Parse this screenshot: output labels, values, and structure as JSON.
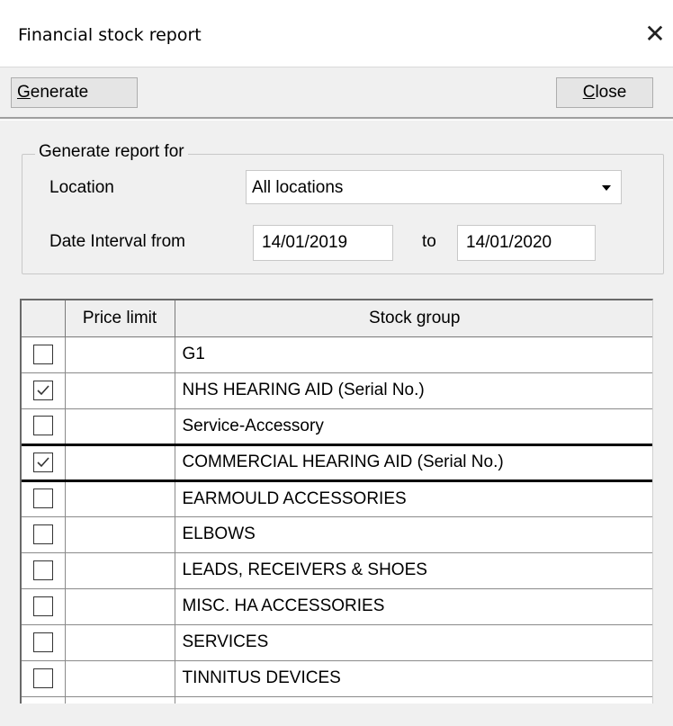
{
  "window": {
    "title": "Financial stock report",
    "close_glyph": "✕"
  },
  "toolbar": {
    "generate": {
      "mnemonic": "G",
      "rest": "enerate"
    },
    "close": {
      "mnemonic": "C",
      "rest": "lose"
    }
  },
  "report_for": {
    "legend": "Generate report for",
    "location_label": "Location",
    "location_value": "All locations",
    "date_label": "Date Interval from",
    "date_from": "14/01/2019",
    "to_label": "to",
    "date_to": "14/01/2020"
  },
  "grid": {
    "columns": [
      "",
      "Price limit",
      "Stock group"
    ],
    "rows": [
      {
        "checked": false,
        "price_limit": "",
        "group": "G1"
      },
      {
        "checked": true,
        "price_limit": "",
        "group": "NHS HEARING AID (Serial No.)"
      },
      {
        "checked": false,
        "price_limit": "",
        "group": "Service-Accessory"
      },
      {
        "checked": true,
        "price_limit": "",
        "group": "COMMERCIAL HEARING AID (Serial No.)",
        "selected": true
      },
      {
        "checked": false,
        "price_limit": "",
        "group": "EARMOULD ACCESSORIES"
      },
      {
        "checked": false,
        "price_limit": "",
        "group": "ELBOWS"
      },
      {
        "checked": false,
        "price_limit": "",
        "group": "LEADS, RECEIVERS & SHOES"
      },
      {
        "checked": false,
        "price_limit": "",
        "group": "MISC. HA ACCESSORIES"
      },
      {
        "checked": false,
        "price_limit": "",
        "group": "SERVICES"
      },
      {
        "checked": false,
        "price_limit": "",
        "group": "TINNITUS DEVICES"
      }
    ]
  },
  "icons": {
    "close": "close-icon",
    "dropdown": "chevron-down-icon",
    "check": "check-icon"
  }
}
